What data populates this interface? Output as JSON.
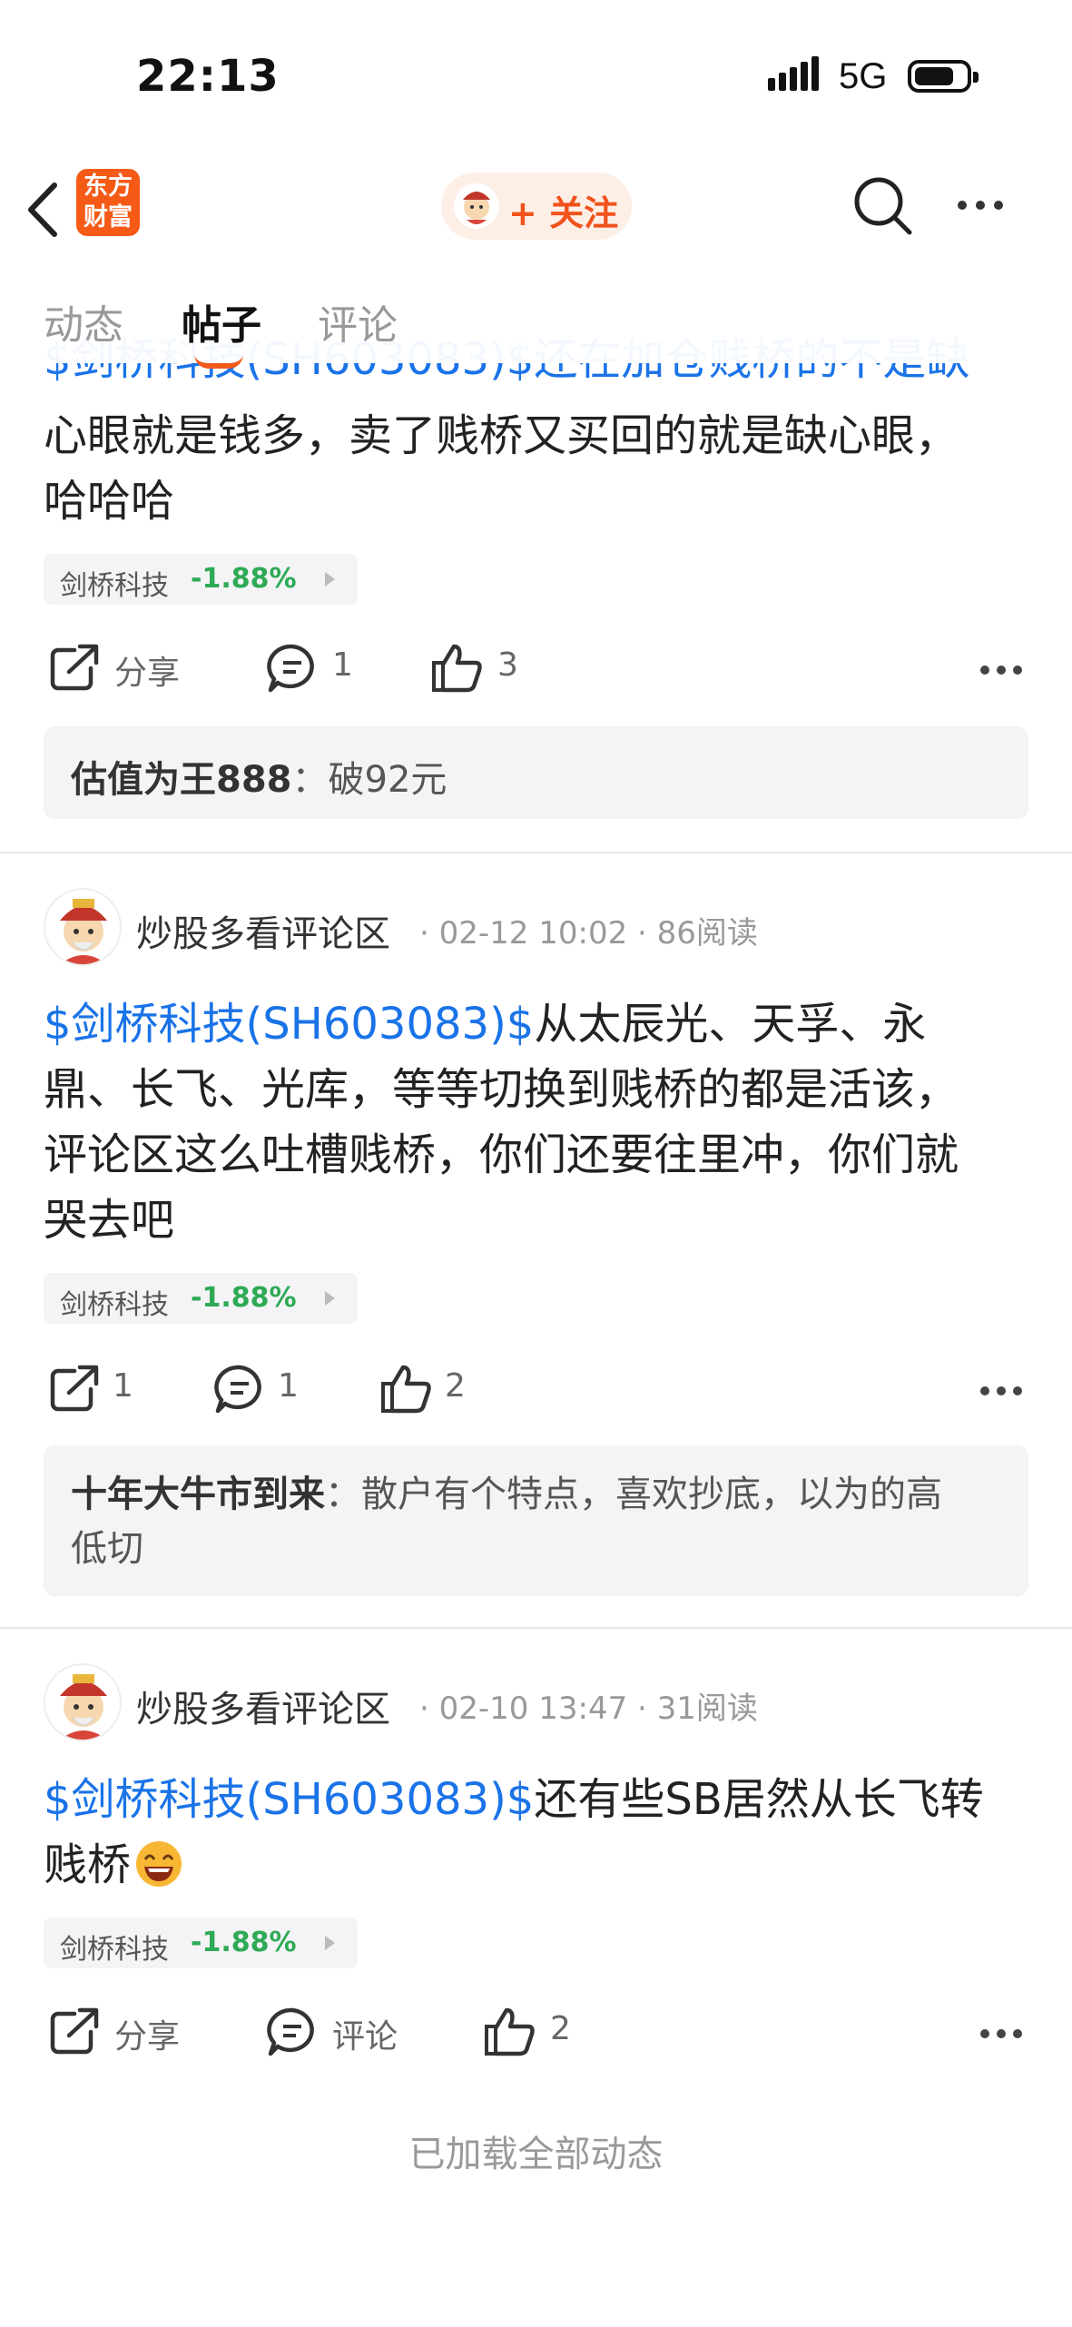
{
  "status_bar": {
    "time": "22:13",
    "network": "5G"
  },
  "nav": {
    "logo_line1": "东方",
    "logo_line2": "财富",
    "follow_label": "+ 关注"
  },
  "tabs": [
    {
      "label": "动态"
    },
    {
      "label": "帖子"
    },
    {
      "label": "评论"
    }
  ],
  "posts": [
    {
      "text_partial": "$剑桥科技(SH603083)$还在加仓贱桥的不是缺心眼就是钱多，卖了贱桥又买回的就是缺心眼，",
      "line1": "心眼就是钱多，卖了贱桥又买回的就是缺心眼，",
      "line2": "哈哈哈",
      "top_clipped": "$剑桥科技(SH603083)$还在加仓贱桥的不是缺",
      "stock_chip": {
        "name": "剑桥科技",
        "change": "-1.88%"
      },
      "share_label": "分享",
      "comment_count": "1",
      "like_count": "3",
      "comment": {
        "author": "估值为王888",
        "separator": "：",
        "text": "破92元"
      }
    },
    {
      "author": "炒股多看评论区",
      "date": "02-12 10:02",
      "reads": "86阅读",
      "stock_tag": "$剑桥科技(SH603083)$",
      "body_line1": "从太辰光、天孚、永",
      "body_line2": "鼎、长飞、光库，等等切换到贱桥的都是活该，",
      "body_line3": "评论区这么吐槽贱桥，你们还要往里冲，你们就",
      "body_line4": "哭去吧",
      "stock_chip": {
        "name": "剑桥科技",
        "change": "-1.88%"
      },
      "share_count": "1",
      "comment_count": "1",
      "like_count": "2",
      "comment": {
        "author": "十年大牛市到来",
        "separator": "：",
        "text_line1": "散户有个特点，喜欢抄底，以为的高",
        "text_line2": "低切"
      }
    },
    {
      "author": "炒股多看评论区",
      "date": "02-10 13:47",
      "reads": "31阅读",
      "stock_tag": "$剑桥科技(SH603083)$",
      "body_line1": "还有些SB居然从长飞转",
      "body_line2": "贱桥",
      "stock_chip": {
        "name": "剑桥科技",
        "change": "-1.88%"
      },
      "share_label": "分享",
      "comment_label": "评论",
      "like_count": "2"
    }
  ],
  "footer": {
    "text": "已加载全部动态"
  },
  "colors": {
    "accent": "#f25a1c",
    "link": "#1a73e8",
    "down_green": "#2eaa55"
  }
}
